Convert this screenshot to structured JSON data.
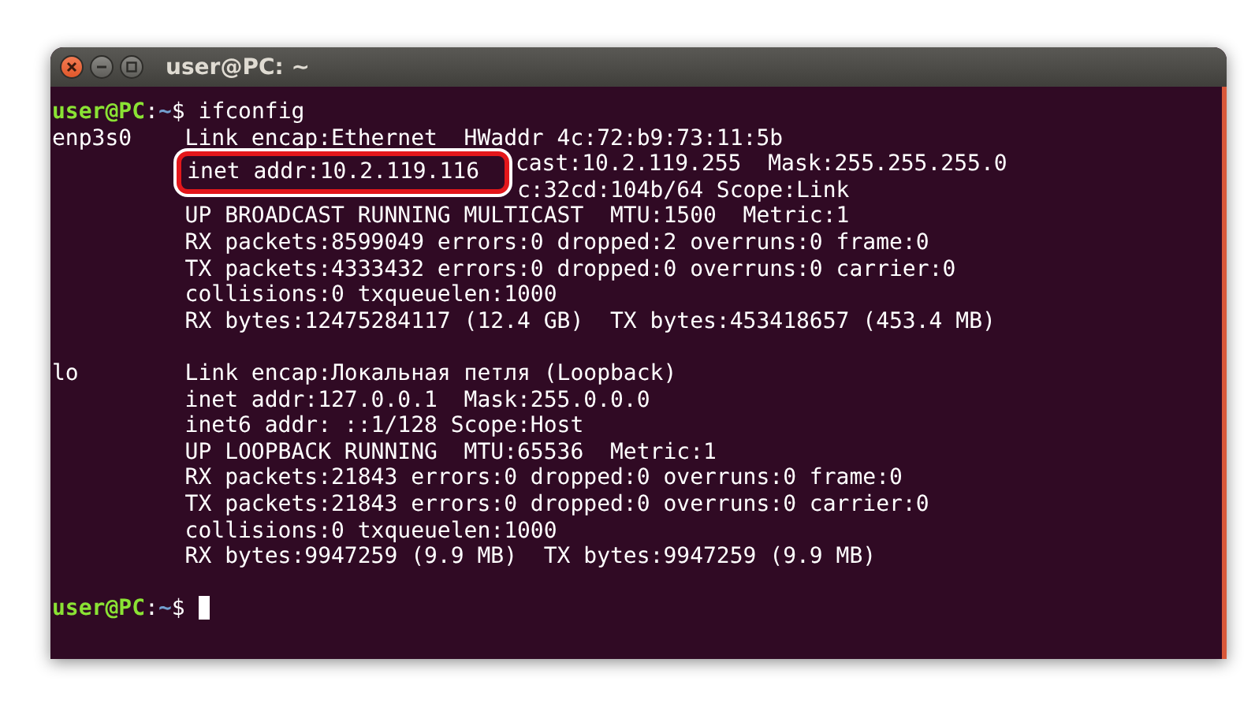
{
  "window": {
    "title": "user@PC: ~"
  },
  "lines": [
    {
      "kind": "prompt",
      "host": "user@PC",
      "sep": ":",
      "path": "~",
      "symbol": "$",
      "command": "ifconfig"
    },
    {
      "kind": "output",
      "iface": "enp3s0",
      "text": "Link encap:Ethernet  HWaddr 4c:72:b9:73:11:5b"
    },
    {
      "kind": "highlighted",
      "highlight": "inet addr:10.2.119.116",
      "text": "cast:10.2.119.255  Mask:255.255.255.0"
    },
    {
      "kind": "obscured",
      "text": "c:32cd:104b/64 Scope:Link"
    },
    {
      "kind": "output",
      "text": "UP BROADCAST RUNNING MULTICAST  MTU:1500  Metric:1"
    },
    {
      "kind": "output",
      "text": "RX packets:8599049 errors:0 dropped:2 overruns:0 frame:0"
    },
    {
      "kind": "output",
      "text": "TX packets:4333432 errors:0 dropped:0 overruns:0 carrier:0"
    },
    {
      "kind": "output",
      "text": "collisions:0 txqueuelen:1000"
    },
    {
      "kind": "output",
      "text": "RX bytes:12475284117 (12.4 GB)  TX bytes:453418657 (453.4 MB)"
    },
    {
      "kind": "blank"
    },
    {
      "kind": "output",
      "iface": "lo",
      "text": "Link encap:Локальная петля (Loopback)"
    },
    {
      "kind": "output",
      "text": "inet addr:127.0.0.1  Mask:255.0.0.0"
    },
    {
      "kind": "output",
      "text": "inet6 addr: ::1/128 Scope:Host"
    },
    {
      "kind": "output",
      "text": "UP LOOPBACK RUNNING  MTU:65536  Metric:1"
    },
    {
      "kind": "output",
      "text": "RX packets:21843 errors:0 dropped:0 overruns:0 frame:0"
    },
    {
      "kind": "output",
      "text": "TX packets:21843 errors:0 dropped:0 overruns:0 carrier:0"
    },
    {
      "kind": "output",
      "text": "collisions:0 txqueuelen:1000"
    },
    {
      "kind": "output",
      "text": "RX bytes:9947259 (9.9 MB)  TX bytes:9947259 (9.9 MB)"
    },
    {
      "kind": "blank"
    },
    {
      "kind": "prompt",
      "host": "user@PC",
      "sep": ":",
      "path": "~",
      "symbol": "$",
      "cursor": true
    }
  ]
}
